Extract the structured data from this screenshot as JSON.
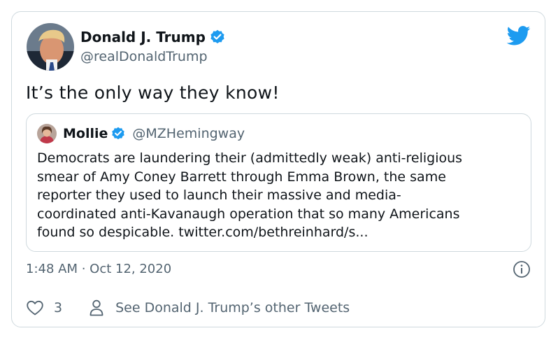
{
  "author": {
    "name": "Donald J. Trump",
    "handle": "@realDonaldTrump"
  },
  "tweet": {
    "text": "It’s the only way they know!",
    "timestamp": "1:48 AM · Oct 12, 2020"
  },
  "quoted": {
    "name": "Mollie",
    "handle": "@MZHemingway",
    "lines": [
      "Democrats are laundering their (admittedly weak) anti-religious",
      "smear of Amy Coney Barrett through Emma Brown, the same",
      "reporter they used to launch their massive and media-",
      "coordinated anti-Kavanaugh operation that so many Americans",
      "found so despicable. twitter.com/bethreinhard/s..."
    ]
  },
  "footer": {
    "like_count": "3",
    "other_tweets_label": "See Donald J. Trump’s other Tweets"
  },
  "colors": {
    "accent": "#1d9bf0",
    "secondary_text": "#536471",
    "border": "#cfd9de"
  },
  "icons": [
    "verified-badge-icon",
    "twitter-bird-icon",
    "info-icon",
    "heart-icon",
    "person-icon"
  ]
}
